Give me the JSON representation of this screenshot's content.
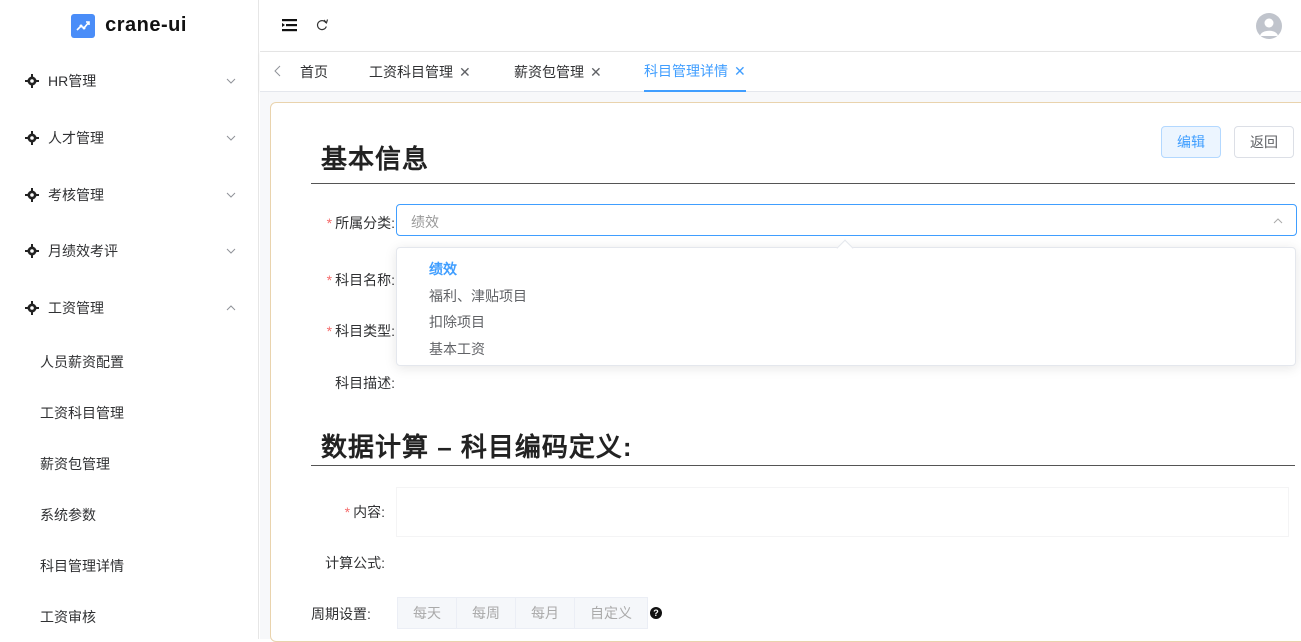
{
  "app": {
    "name": "crane-ui"
  },
  "sidebar": {
    "groups": [
      {
        "label": "HR管理"
      },
      {
        "label": "人才管理"
      },
      {
        "label": "考核管理"
      },
      {
        "label": "月绩效考评"
      },
      {
        "label": "工资管理"
      }
    ],
    "subitems": [
      {
        "label": "人员薪资配置"
      },
      {
        "label": "工资科目管理"
      },
      {
        "label": "薪资包管理"
      },
      {
        "label": "系统参数"
      },
      {
        "label": "科目管理详情"
      },
      {
        "label": "工资审核"
      }
    ]
  },
  "tabs": [
    {
      "label": "首页"
    },
    {
      "label": "工资科目管理"
    },
    {
      "label": "薪资包管理"
    },
    {
      "label": "科目管理详情"
    }
  ],
  "form": {
    "section1_title": "基本信息",
    "edit_button": "编辑",
    "back_button": "返回",
    "category_label": "所属分类:",
    "category_value": "绩效",
    "name_label": "科目名称:",
    "type_label": "科目类型:",
    "desc_label": "科目描述:",
    "section2_title": "数据计算 – 科目编码定义:",
    "content_label": "内容:",
    "formula_label": "计算公式:",
    "period_label": "周期设置:",
    "period_options": [
      "每天",
      "每周",
      "每月",
      "自定义"
    ],
    "required_mark": "*",
    "help_glyph": "?"
  },
  "dropdown": {
    "options": [
      "绩效",
      "福利、津贴项目",
      "扣除项目",
      "基本工资"
    ],
    "selected": "绩效"
  },
  "colors": {
    "accent": "#409eff",
    "required": "#f56c6c",
    "logo": "#4a8df8"
  }
}
